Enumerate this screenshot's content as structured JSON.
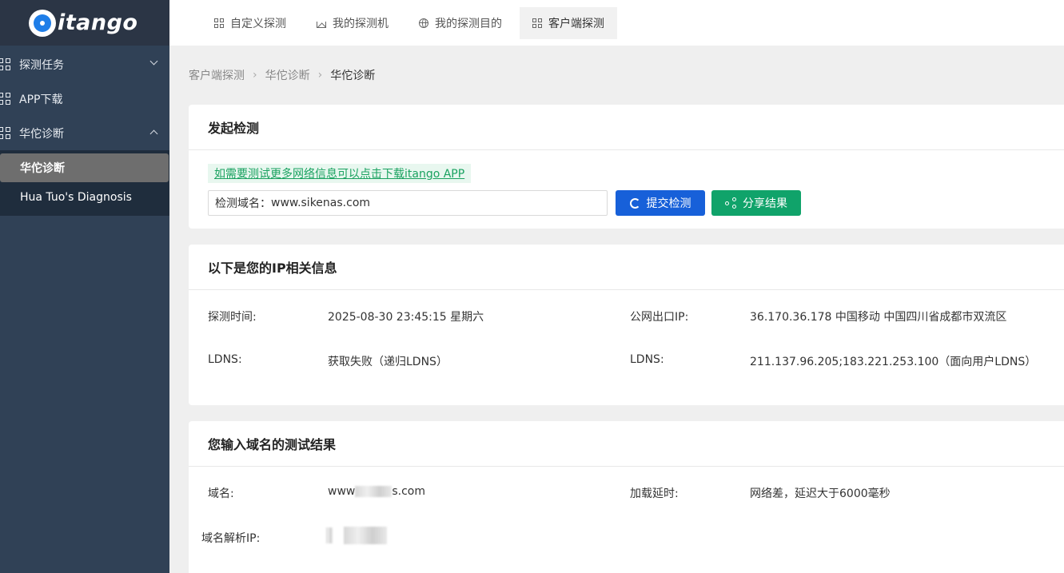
{
  "sidebar": {
    "logo_text": "itango",
    "menu": [
      {
        "label": "探测任务"
      },
      {
        "label": "APP下载"
      },
      {
        "label": "华佗诊断"
      }
    ],
    "submenu": [
      {
        "label": "华佗诊断"
      },
      {
        "label": "Hua Tuo's Diagnosis"
      }
    ]
  },
  "topnav": {
    "tabs": [
      {
        "label": "自定义探测"
      },
      {
        "label": "我的探测机"
      },
      {
        "label": "我的探测目的"
      },
      {
        "label": "客户端探测"
      }
    ]
  },
  "breadcrumb": [
    "客户端探测",
    "华佗诊断",
    "华佗诊断"
  ],
  "detect": {
    "title": "发起检测",
    "hint": "如需要测试更多网络信息可以点击下载itango APP",
    "domain_label": "检测域名：",
    "domain_value": "www.sikenas.com",
    "submit_label": "提交检测",
    "share_label": "分享结果"
  },
  "ipinfo": {
    "title": "以下是您的IP相关信息",
    "time_label": "探测时间:",
    "time_value": "2025-08-30 23:45:15 星期六",
    "ip_label": "公网出口IP:",
    "ip_value": "36.170.36.178 中国移动 中国四川省成都市双流区",
    "ldns_label": "LDNS:",
    "ldns_value": "获取失败（递归LDNS）",
    "ldns2_label": "LDNS:",
    "ldns2_value": "211.137.96.205;183.221.253.100（面向用户LDNS）"
  },
  "result": {
    "title": "您输入域名的测试结果",
    "domain_label": "域名:",
    "domain_prefix": "www",
    "domain_suffix": "s.com",
    "delay_label": "加载延时:",
    "delay_value": "网络差，延迟大于6000毫秒",
    "resolve_label": "域名解析IP:"
  }
}
